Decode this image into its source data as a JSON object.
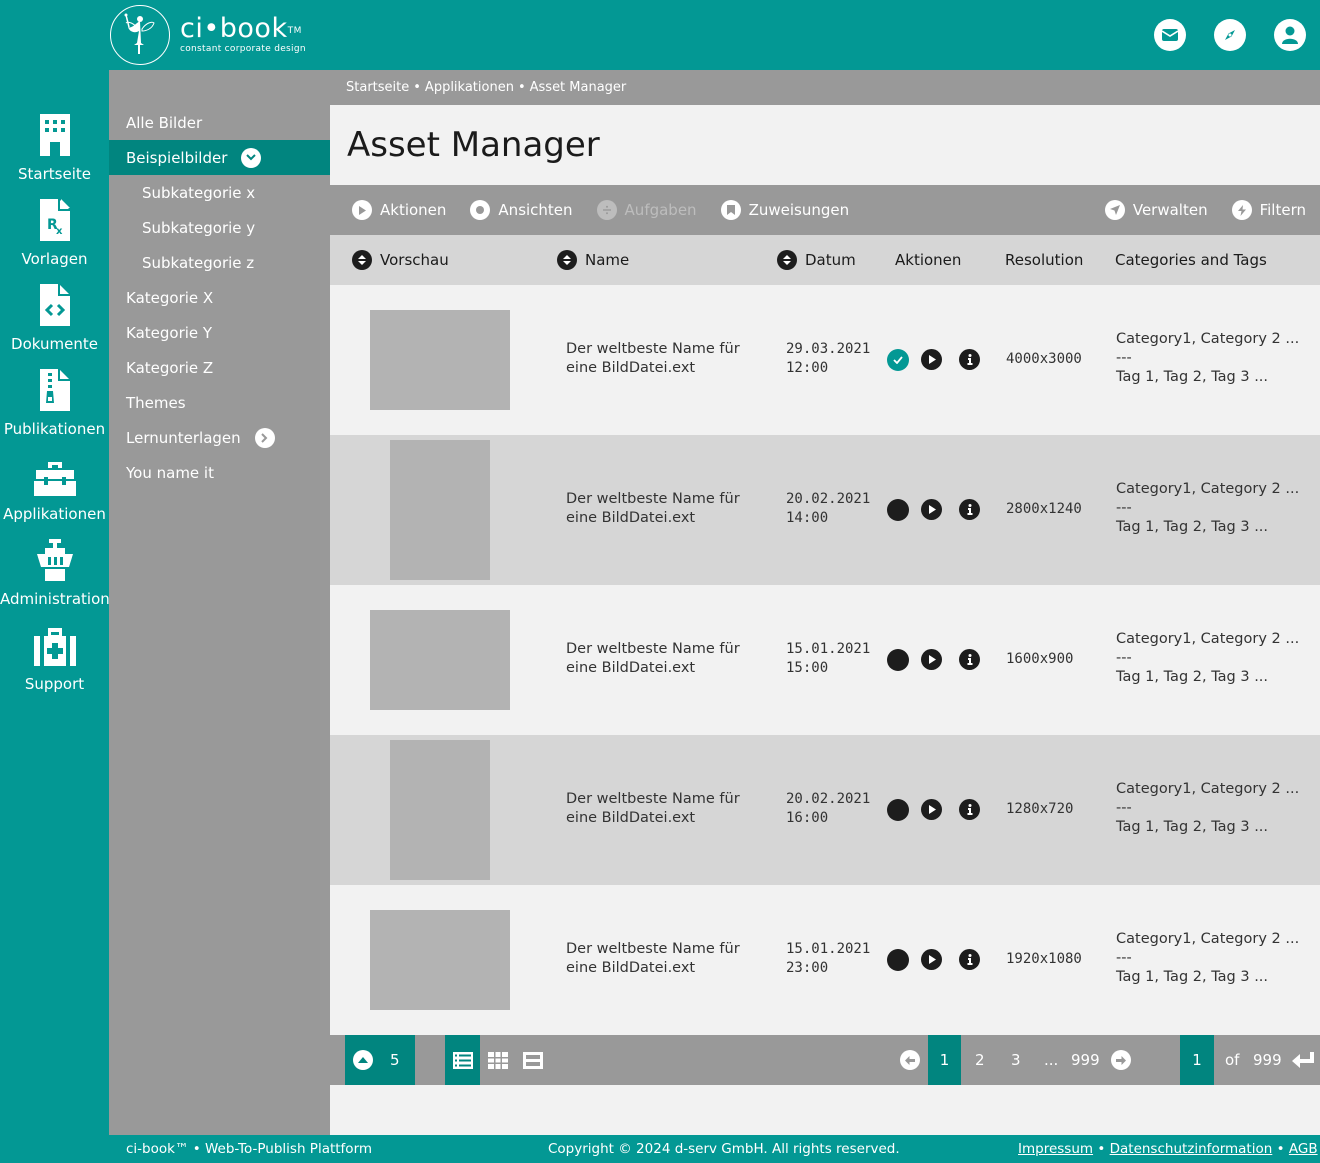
{
  "brand": {
    "name": "ci•book",
    "trademark": "TM",
    "tagline": "constant corporate design"
  },
  "header_icons": [
    {
      "name": "mail-icon"
    },
    {
      "name": "compass-icon"
    },
    {
      "name": "user-icon"
    }
  ],
  "leftnav": {
    "items": [
      {
        "label": "Startseite",
        "icon": "building-icon"
      },
      {
        "label": "Vorlagen",
        "icon": "prescription-file-icon"
      },
      {
        "label": "Dokumente",
        "icon": "code-file-icon"
      },
      {
        "label": "Publikationen",
        "icon": "zip-file-icon"
      },
      {
        "label": "Applikationen",
        "icon": "toolbox-icon"
      },
      {
        "label": "Administration",
        "icon": "control-tower-icon"
      },
      {
        "label": "Support",
        "icon": "medkit-icon"
      }
    ]
  },
  "categories": {
    "items": [
      {
        "label": "Alle Bilder"
      },
      {
        "label": "Beispielbilder",
        "active": true,
        "badge": "chevron-down-icon"
      },
      {
        "label": "Subkategorie x",
        "sub": true
      },
      {
        "label": "Subkategorie y",
        "sub": true
      },
      {
        "label": "Subkategorie z",
        "sub": true
      },
      {
        "label": "Kategorie X"
      },
      {
        "label": "Kategorie Y"
      },
      {
        "label": "Kategorie Z"
      },
      {
        "label": "Themes"
      },
      {
        "label": "Lernunterlagen",
        "badge": "chevron-right-icon"
      },
      {
        "label": "You name it"
      }
    ]
  },
  "breadcrumb": {
    "items": [
      "Startseite",
      "Applikationen",
      "Asset Manager"
    ],
    "separator": "•"
  },
  "page_title": "Asset Manager",
  "toolbar": {
    "left": [
      {
        "label": "Aktionen",
        "icon": "play-circle-icon"
      },
      {
        "label": "Ansichten",
        "icon": "dot-circle-icon"
      },
      {
        "label": "Aufgaben",
        "icon": "divide-circle-icon",
        "disabled": true
      },
      {
        "label": "Zuweisungen",
        "icon": "bookmark-circle-icon"
      }
    ],
    "right": [
      {
        "label": "Verwalten",
        "icon": "location-arrow-icon"
      },
      {
        "label": "Filtern",
        "icon": "bolt-icon"
      }
    ]
  },
  "table": {
    "columns": [
      {
        "label": "Vorschau",
        "sortable": true
      },
      {
        "label": "Name",
        "sortable": true
      },
      {
        "label": "Datum",
        "sortable": true
      },
      {
        "label": "Aktionen",
        "sortable": false
      },
      {
        "label": "Resolution",
        "sortable": false
      },
      {
        "label": "Categories and Tags",
        "sortable": false
      }
    ],
    "rows": [
      {
        "orientation": "landscape",
        "name_line1": "Der weltbeste Name für",
        "name_line2": "eine BildDatei.ext",
        "date": "29.03.2021",
        "time": "12:00",
        "selected": true,
        "resolution": "4000x3000",
        "categories": "Category1, Category 2 ...",
        "divider": "---",
        "tags": "Tag 1, Tag 2, Tag 3 ..."
      },
      {
        "orientation": "portrait",
        "name_line1": "Der weltbeste Name für",
        "name_line2": "eine BildDatei.ext",
        "date": "20.02.2021",
        "time": "14:00",
        "selected": false,
        "resolution": "2800x1240",
        "categories": "Category1, Category 2 ...",
        "divider": "---",
        "tags": "Tag 1, Tag 2, Tag 3 ..."
      },
      {
        "orientation": "landscape",
        "name_line1": "Der weltbeste Name für",
        "name_line2": "eine BildDatei.ext",
        "date": "15.01.2021",
        "time": "15:00",
        "selected": false,
        "resolution": "1600x900",
        "categories": "Category1, Category 2 ...",
        "divider": "---",
        "tags": "Tag 1, Tag 2, Tag 3 ..."
      },
      {
        "orientation": "portrait",
        "name_line1": "Der weltbeste Name für",
        "name_line2": "eine BildDatei.ext",
        "date": "20.02.2021",
        "time": "16:00",
        "selected": false,
        "resolution": "1280x720",
        "categories": "Category1, Category 2 ...",
        "divider": "---",
        "tags": "Tag 1, Tag 2, Tag 3 ..."
      },
      {
        "orientation": "landscape",
        "name_line1": "Der weltbeste Name für",
        "name_line2": "eine BildDatei.ext",
        "date": "15.01.2021",
        "time": "23:00",
        "selected": false,
        "resolution": "1920x1080",
        "categories": "Category1, Category 2 ...",
        "divider": "---",
        "tags": "Tag 1, Tag 2, Tag 3 ..."
      }
    ]
  },
  "pager": {
    "per_page": "5",
    "views": [
      "list-view-icon",
      "grid-view-icon",
      "split-view-icon"
    ],
    "active_view": "list-view-icon",
    "pages": [
      "1",
      "2",
      "3",
      "...",
      "999"
    ],
    "current_page": "1",
    "jump_value": "1",
    "of_label": "of",
    "total_pages": "999"
  },
  "footer": {
    "left": "ci-book™ • Web-To-Publish Plattform",
    "copyright": "Copyright © 2024 d-serv GmbH. All rights reserved.",
    "links": [
      "Impressum",
      "Datenschutzinformation",
      "AGB"
    ],
    "separator": "•"
  },
  "colors": {
    "brand_teal": "#039894",
    "active_teal": "#01857f",
    "panel_gray": "#999999",
    "row_gray": "#d6d6d6",
    "row_light": "#f2f2f2",
    "thumb_gray": "#b3b3b3"
  }
}
